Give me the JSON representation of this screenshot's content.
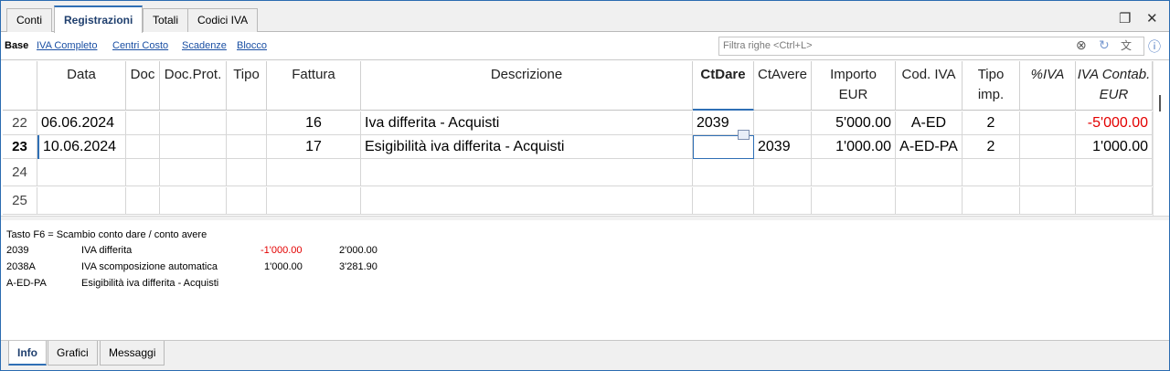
{
  "top_tabs": [
    "Conti",
    "Registrazioni",
    "Totali",
    "Codici IVA"
  ],
  "views": [
    "Base",
    "IVA Completo",
    "Centri Costo",
    "Scadenze",
    "Blocco"
  ],
  "filter_placeholder": "Filtra righe <Ctrl+L>",
  "columns": {
    "data": "Data",
    "doc": "Doc",
    "doc_prot": "Doc.Prot.",
    "tipo": "Tipo",
    "fattura": "Fattura",
    "descrizione": "Descrizione",
    "ctdare": "CtDare",
    "ctavere": "CtAvere",
    "importo_1": "Importo",
    "importo_2": "EUR",
    "cod_iva": "Cod. IVA",
    "tipo_imp_1": "Tipo",
    "tipo_imp_2": "imp.",
    "perc_iva": "%IVA",
    "iva_contab_1": "IVA Contab.",
    "iva_contab_2": "EUR"
  },
  "rows": [
    {
      "num": "22",
      "data": "06.06.2024",
      "doc": "",
      "doc_prot": "",
      "tipo": "",
      "fattura": "16",
      "descrizione": "Iva differita  - Acquisti",
      "ctdare": "2039",
      "ctavere": "",
      "importo": "5'000.00",
      "cod_iva": "A-ED",
      "tipo_imp": "2",
      "perc_iva": "",
      "iva_contab": "-5'000.00"
    },
    {
      "num": "23",
      "data": "10.06.2024",
      "doc": "",
      "doc_prot": "",
      "tipo": "",
      "fattura": "17",
      "descrizione": "Esigibilità iva differita - Acquisti",
      "ctdare": "",
      "ctavere": "2039",
      "importo": "1'000.00",
      "cod_iva": "A-ED-PA",
      "tipo_imp": "2",
      "perc_iva": "",
      "iva_contab": "1'000.00"
    },
    {
      "num": "24",
      "data": "",
      "doc": "",
      "doc_prot": "",
      "tipo": "",
      "fattura": "",
      "descrizione": "",
      "ctdare": "",
      "ctavere": "",
      "importo": "",
      "cod_iva": "",
      "tipo_imp": "",
      "perc_iva": "",
      "iva_contab": ""
    },
    {
      "num": "25",
      "data": "",
      "doc": "",
      "doc_prot": "",
      "tipo": "",
      "fattura": "",
      "descrizione": "",
      "ctdare": "",
      "ctavere": "",
      "importo": "",
      "cod_iva": "",
      "tipo_imp": "",
      "perc_iva": "",
      "iva_contab": ""
    }
  ],
  "info": {
    "hint": "Tasto F6 = Scambio conto dare / conto avere",
    "lines": [
      {
        "code": "2039",
        "label": "IVA differita",
        "amount": "-1'000.00",
        "balance": "2'000.00",
        "amount_negative": true
      },
      {
        "code": "2038A",
        "label": "IVA scomposizione automatica",
        "amount": "1'000.00",
        "balance": "3'281.90",
        "amount_negative": false
      },
      {
        "code": "A-ED-PA",
        "label": "Esigibilità iva differita - Acquisti",
        "amount": "",
        "balance": "",
        "amount_negative": false
      }
    ]
  },
  "bottom_tabs": [
    "Info",
    "Grafici",
    "Messaggi"
  ]
}
